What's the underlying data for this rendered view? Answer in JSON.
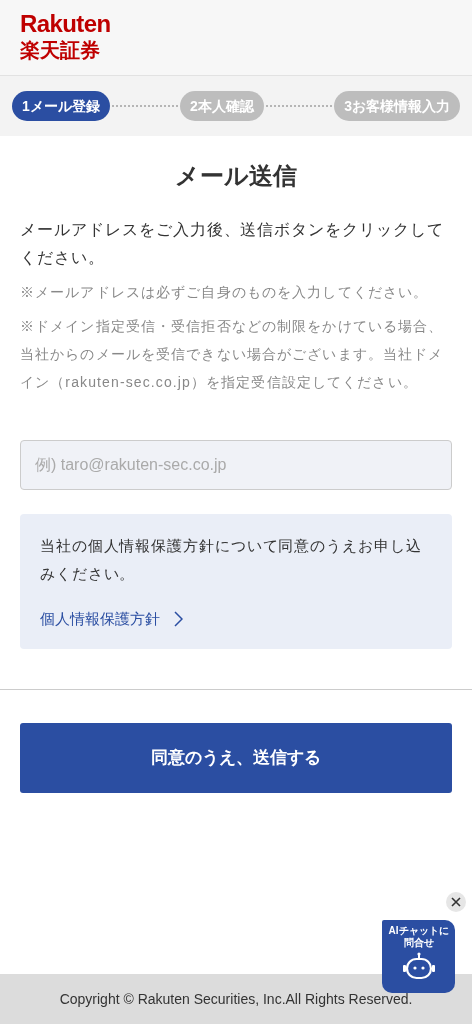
{
  "header": {
    "logo_latin": "Rakuten",
    "logo_japanese": "楽天証券"
  },
  "steps": [
    {
      "number": "1",
      "label": "メール登録",
      "selected": true
    },
    {
      "number": "2",
      "label": "本人確認",
      "selected": false
    },
    {
      "number": "3",
      "label": "お客様情報入力",
      "selected": false
    }
  ],
  "title": "メール送信",
  "intro": "メールアドレスをご入力後、送信ボタンをクリックしてください。",
  "notes": [
    "※メールアドレスは必ずご自身のものを入力してください。",
    "※ドメイン指定受信・受信拒否などの制限をかけている場合、当社からのメールを受信できない場合がございます。当社ドメイン（rakuten-sec.co.jp）を指定受信設定してください。"
  ],
  "email_field": {
    "placeholder": "例) taro@rakuten-sec.co.jp"
  },
  "consent": {
    "text": "当社の個人情報保護方針について同意のうえお申し込みください。",
    "link": "個人情報保護方針"
  },
  "submit_button": "同意のうえ、送信する",
  "chat_widget": {
    "label_lines": [
      "AIチャットに",
      "問合せ"
    ]
  },
  "footer": "Copyright © Rakuten Securities, Inc.All Rights Reserved."
}
